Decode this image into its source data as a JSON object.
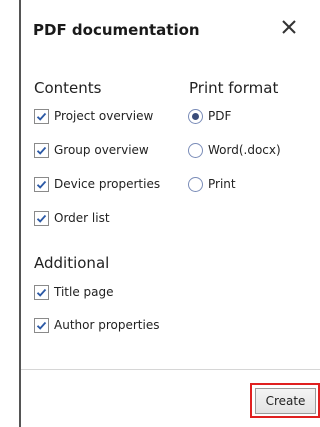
{
  "dialog": {
    "title": "PDF documentation",
    "close_icon": "close-icon"
  },
  "contents": {
    "heading": "Contents",
    "items": [
      {
        "label": "Project overview",
        "checked": true
      },
      {
        "label": "Group overview",
        "checked": true
      },
      {
        "label": "Device properties",
        "checked": true
      },
      {
        "label": "Order list",
        "checked": true
      }
    ]
  },
  "print_format": {
    "heading": "Print format",
    "options": [
      {
        "label": "PDF",
        "selected": true
      },
      {
        "label": "Word(.docx)",
        "selected": false
      },
      {
        "label": "Print",
        "selected": false
      }
    ]
  },
  "additional": {
    "heading": "Additional",
    "items": [
      {
        "label": "Title page",
        "checked": true
      },
      {
        "label": "Author properties",
        "checked": true
      }
    ]
  },
  "footer": {
    "create_label": "Create",
    "highlight_color": "#e02020"
  }
}
